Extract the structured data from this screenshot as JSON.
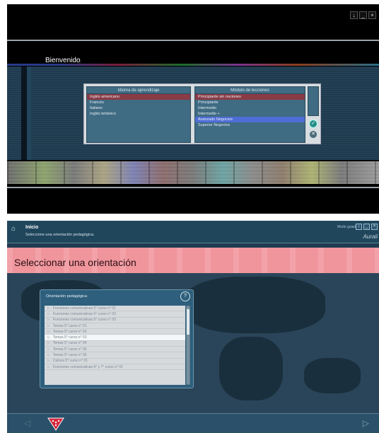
{
  "top_screen": {
    "welcome": "Bienvenido",
    "welcome_ghost": "o",
    "languages_header": "Idioma de aprendizaje",
    "languages": [
      {
        "label": "Inglés americano",
        "selected": true
      },
      {
        "label": "Francés",
        "selected": false
      },
      {
        "label": "Italiano",
        "selected": false
      },
      {
        "label": "Inglés británico",
        "selected": false
      }
    ],
    "modules_header": "Módulo de lecciones",
    "modules": [
      {
        "label": "Principiante sin nociones",
        "state": "selected"
      },
      {
        "label": "Principiante",
        "state": ""
      },
      {
        "label": "Intermedio",
        "state": ""
      },
      {
        "label": "Intermedio +",
        "state": ""
      },
      {
        "label": "Avanzado Negocios",
        "state": "highlight"
      },
      {
        "label": "Superior Negocios",
        "state": ""
      }
    ],
    "ok_icon": "✓",
    "cancel_icon": "✕",
    "window_buttons": [
      "↓",
      "_",
      "×"
    ]
  },
  "bottom_screen": {
    "title": "Inicio",
    "subtitle": "Seleccione una orientación pedagógica.",
    "mode": "Modo guiado",
    "window_buttons": [
      "↓",
      "_",
      "×"
    ],
    "brand": "Aurali",
    "home_icon": "⌂",
    "banner": "Seleccionar una orientación",
    "dialog": {
      "title": "Orientación pedagógica",
      "help_icon": "?",
      "items": [
        {
          "label": "Funciones comunicativas 5° curso n° 01",
          "selected": false
        },
        {
          "label": "Funciones comunicativas 5° curso n° 02",
          "selected": false
        },
        {
          "label": "Funciones comunicativas 5° curso n° 03",
          "selected": false
        },
        {
          "label": "Temas 5° curso n° 01",
          "selected": false
        },
        {
          "label": "Temas 5° curso n° 02",
          "selected": false
        },
        {
          "label": "Temas 5° curso n° 03",
          "selected": true
        },
        {
          "label": "Temas 5° curso n° 04",
          "selected": false
        },
        {
          "label": "Temas 5° curso n° 05",
          "selected": false
        },
        {
          "label": "Temas 5° curso n° 06",
          "selected": false
        },
        {
          "label": "Cultura 5° curso n° 01",
          "selected": false
        },
        {
          "label": "Funciones comunicativas 6° y 7° curso n° 01",
          "selected": false
        }
      ]
    },
    "footer_prev_icon": "◁",
    "footer_next_icon": "▷"
  }
}
